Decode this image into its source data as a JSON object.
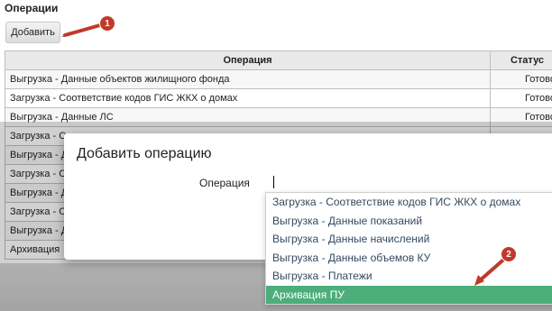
{
  "page": {
    "title": "Операции"
  },
  "toolbar": {
    "add_label": "Добавить"
  },
  "table": {
    "columns": [
      "Операция",
      "Статус"
    ],
    "rows": [
      {
        "operation": "Выгрузка - Данные объектов жилищного фонда",
        "status": "Готово"
      },
      {
        "operation": "Загрузка - Соответствие кодов ГИС ЖКХ о домах",
        "status": "Готово"
      },
      {
        "operation": "Выгрузка - Данные ЛС",
        "status": "Готово"
      },
      {
        "operation": "Загрузка - С",
        "status": ""
      },
      {
        "operation": "Выгрузка - Д",
        "status": ""
      },
      {
        "operation": "Загрузка - С",
        "status": ""
      },
      {
        "operation": "Выгрузка - Д",
        "status": ""
      },
      {
        "operation": "Загрузка - С",
        "status": ""
      },
      {
        "operation": "Выгрузка - Д",
        "status": ""
      },
      {
        "operation": "Архивация",
        "status": ""
      }
    ]
  },
  "dialog": {
    "title": "Добавить операцию",
    "field_label": "Операция",
    "options": [
      "Загрузка - Соответствие кодов ГИС ЖКХ о домах",
      "Выгрузка - Данные показаний",
      "Выгрузка - Данные начислений",
      "Выгрузка - Данные объемов КУ",
      "Выгрузка - Платежи",
      "Архивация ПУ"
    ],
    "selected_index": 5
  },
  "annotations": {
    "badge1": "1",
    "badge2": "2",
    "color": "#c0392b"
  }
}
